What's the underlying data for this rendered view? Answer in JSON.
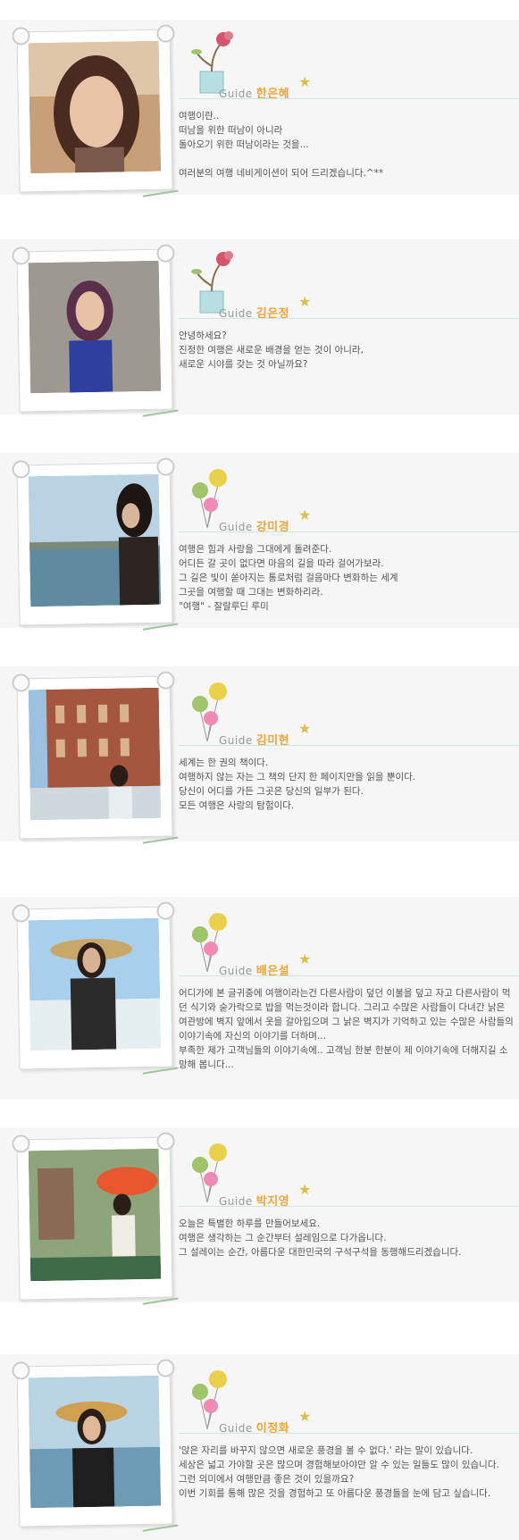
{
  "profiles": [
    {
      "label": "Guide",
      "name": "한은혜",
      "lines": [
        "여행이란..",
        "떠남을 위한 떠남이 아니라",
        "돌아오기 위한 떠남이라는 것을...",
        "",
        "여러분의 여행 네비게이션이 되어 드리겠습니다.^**"
      ]
    },
    {
      "label": "Guide",
      "name": "김은정",
      "lines": [
        "안녕하세요?",
        "진정한 여행은 새로운 배경을 얻는 것이 아니라,",
        "새로운 시야를 갖는 것 아닐까요?"
      ]
    },
    {
      "label": "Guide",
      "name": "강미경",
      "lines": [
        "여행은 힘과 사랑을 그대에게 돌려준다.",
        "어디든 갈 곳이 없다면 마음의 길을 따라 걸어가보라.",
        "그 길은 빛이 쏟아지는 통로처럼 걸음마다 변화하는 세계",
        "그곳을 여행할 때 그대는 변화하리라.",
        "\"여행\" - 잘랄루딘 루미"
      ]
    },
    {
      "label": "Guide",
      "name": "김미현",
      "lines": [
        "세계는 한 권의 책이다.",
        "여행하지 않는 자는 그 책의 단지 한 페이지만을 읽을 뿐이다.",
        "당신이 어디를 가든 그곳은 당신의 일부가 된다.",
        "모든 여행은 사랑의 탐험이다."
      ]
    },
    {
      "label": "Guide",
      "name": "배은설",
      "lines": [
        "어디가에 본 글귀중에 여행이라는건 다른사람이 덮던 이불을 덮고 자고 다른사람이 먹던 식기와 숟가락으로 밥을 먹는것이라 합니다. 그리고 수많은 사람들이 다녀간 낡은 여관방에 벽지 앞에서 옷을 갈아입으며 그 낡은 벽지가 기억하고 있는 수많은 사람들의 이야기속에 자신의 이야기를 더하며...",
        "부족한 제가 고객님들의 이야기속에.. 고객님 한분 한분이 제 이야기속에 더해지길 소망해 봅니다..."
      ]
    },
    {
      "label": "Guide",
      "name": "박지영",
      "lines": [
        "오늘은 특별한 하루를 만들어보세요.",
        "여행은 생각하는 그 순간부터 설레임으로 다가옵니다.",
        "그 설레이는 순간, 아름다운 대한민국의 구석구석을 동행해드리겠습니다."
      ]
    },
    {
      "label": "Guide",
      "name": "이정화",
      "lines": [
        "'앉은 자리를 바꾸지 않으면 새로운 풍경을 볼 수 없다.' 라는 말이 있습니다.",
        "세상은 넓고 가야할 곳은 많으며 경험해보아야만 알 수 있는 일들도 많이 있습니다.",
        "그런 의미에서 여행만큼 좋은 것이 있을까요?",
        "이번 기회를 통해 많은 것을 경험하고 또 아름다운 풍경들을 눈에 담고 싶습니다."
      ]
    }
  ]
}
